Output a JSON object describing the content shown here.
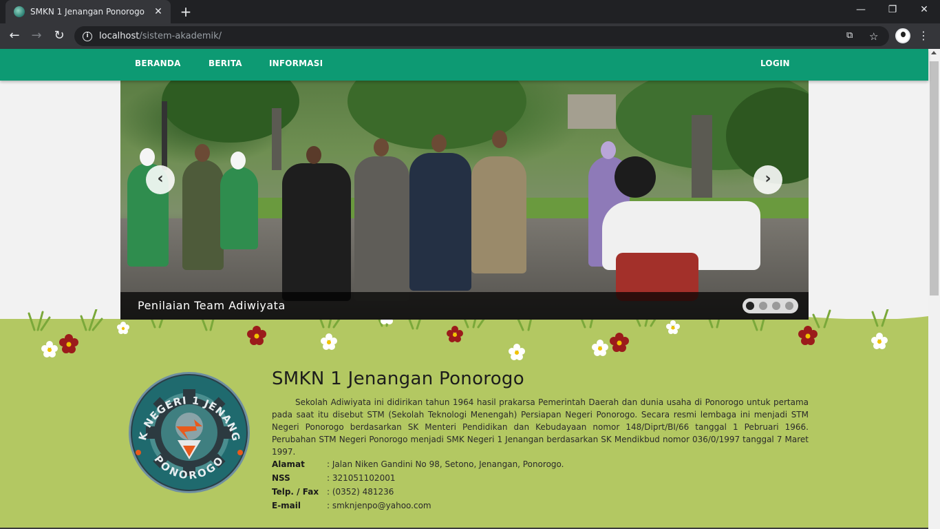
{
  "browser": {
    "tab_title": "SMKN 1 Jenangan Ponorogo",
    "tab_close": "✕",
    "new_tab": "+",
    "url_host": "localhost",
    "url_path": "/sistem-akademik/",
    "window_controls": {
      "minimize": "—",
      "maximize": "❐",
      "close": "✕"
    },
    "nav": {
      "back": "←",
      "forward": "→",
      "reload": "↻"
    },
    "icons": [
      "translate-icon",
      "star-icon",
      "profile-icon",
      "menu-icon"
    ]
  },
  "navbar": {
    "items": [
      {
        "label": "BERANDA"
      },
      {
        "label": "BERITA"
      },
      {
        "label": "INFORMASI"
      }
    ],
    "login": "LOGIN",
    "color": "#0d9a73"
  },
  "carousel": {
    "caption": "Penilaian Team Adiwiyata",
    "prev": "‹",
    "next": "›",
    "slide_count": 4,
    "active_index": 0
  },
  "about": {
    "title": "SMKN 1 Jenangan Ponorogo",
    "description": "Sekolah Adiwiyata ini didirikan tahun 1964 hasil prakarsa Pemerintah Daerah dan dunia usaha di Ponorogo untuk pertama pada saat itu disebut STM (Sekolah Teknologi Menengah) Persiapan Negeri Ponorogo. Secara resmi lembaga ini menjadi STM Negeri Ponorogo berdasarkan SK Menteri Pendidikan dan Kebudayaan nomor 148/Diprt/BI/66 tanggal 1 Pebruari 1966. Perubahan STM Negeri Ponorogo menjadi SMK Negeri 1 Jenangan berdasarkan SK Mendikbud nomor 036/0/1997 tanggal 7 Maret 1997.",
    "logo_text_top": "SMK NEGERI 1 JENANGAN",
    "logo_text_bottom": "PONOROGO",
    "contact": [
      {
        "label": "Alamat",
        "value": ": Jalan Niken Gandini No 98, Setono, Jenangan, Ponorogo."
      },
      {
        "label": "NSS",
        "value": ": 321051102001"
      },
      {
        "label": "Telp. / Fax",
        "value": ": (0352) 481236"
      },
      {
        "label": "E-mail",
        "value": ": smknjenpo@yahoo.com"
      }
    ],
    "background_color": "#b3c862"
  }
}
